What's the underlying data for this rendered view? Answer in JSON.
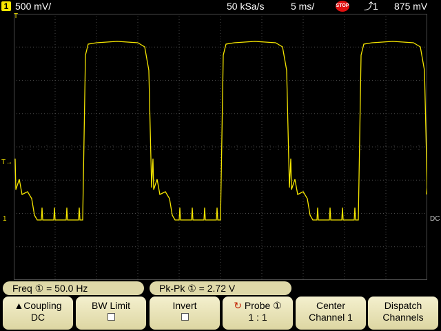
{
  "status": {
    "channel_num": "1",
    "volts_div": "500 mV/",
    "sample_rate": "50 kSa/s",
    "time_div": "5 ms/",
    "run_state": "STOP",
    "trigger": "1",
    "trigger_level": "875 mV"
  },
  "markers": {
    "trig_pos": "T",
    "ground": "1",
    "dc": "DC"
  },
  "measurements": {
    "freq": "Freq ① =  50.0  Hz",
    "pkpk": "Pk-Pk ① =   2.72  V"
  },
  "softkeys": [
    {
      "line1": "Coupling",
      "line2": "DC"
    },
    {
      "line1": "BW Limit",
      "line2": ""
    },
    {
      "line1": "Invert",
      "line2": ""
    },
    {
      "line1": "Probe ①",
      "line2": "1 : 1"
    },
    {
      "line1": "Center",
      "line2": "Channel 1"
    },
    {
      "line1": "Dispatch",
      "line2": "Channels"
    }
  ],
  "colors": {
    "trace": "#f6e600",
    "grid": "#4a4a4a",
    "key_bg": "#e8e2b8"
  }
}
